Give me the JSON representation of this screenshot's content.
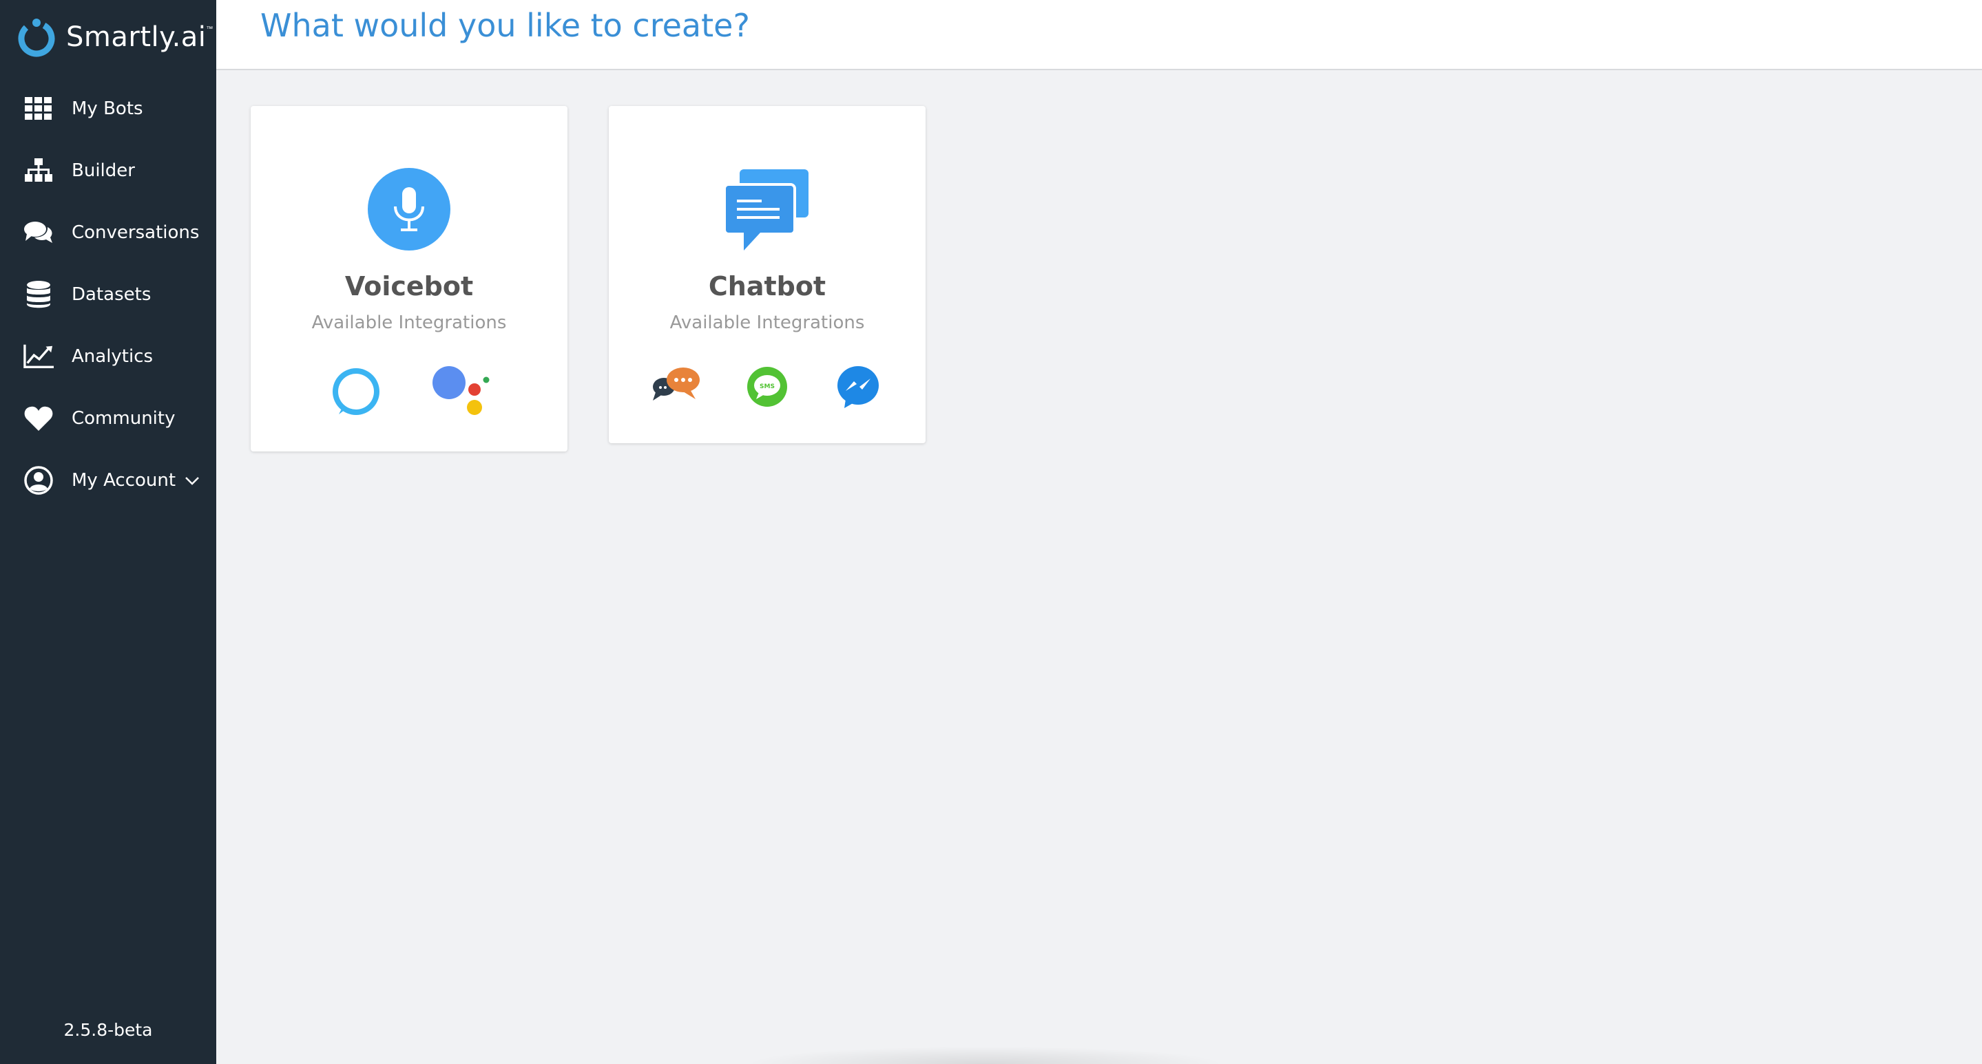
{
  "app": {
    "brand": "Smartly.ai",
    "trademark": "™",
    "version": "2.5.8-beta"
  },
  "sidebar": {
    "items": [
      {
        "label": "My Bots",
        "icon": "grid-icon"
      },
      {
        "label": "Builder",
        "icon": "sitemap-icon"
      },
      {
        "label": "Conversations",
        "icon": "comments-icon"
      },
      {
        "label": "Datasets",
        "icon": "database-icon"
      },
      {
        "label": "Analytics",
        "icon": "line-chart-icon"
      },
      {
        "label": "Community",
        "icon": "heart-icon"
      },
      {
        "label": "My Account",
        "icon": "user-circle-icon"
      }
    ]
  },
  "header": {
    "title": "What would you like to create?"
  },
  "cards": [
    {
      "title": "Voicebot",
      "subtitle": "Available Integrations",
      "icon": "microphone-icon",
      "integrations": [
        "alexa-icon",
        "google-assistant-icon"
      ]
    },
    {
      "title": "Chatbot",
      "subtitle": "Available Integrations",
      "icon": "chat-bubbles-icon",
      "integrations": [
        "web-chat-icon",
        "sms-icon",
        "messenger-icon"
      ]
    }
  ],
  "colors": {
    "sidebar_bg": "#1f2b36",
    "accent": "#3a8fd6",
    "icon_blue": "#42a5f5",
    "content_bg": "#f1f2f4"
  }
}
